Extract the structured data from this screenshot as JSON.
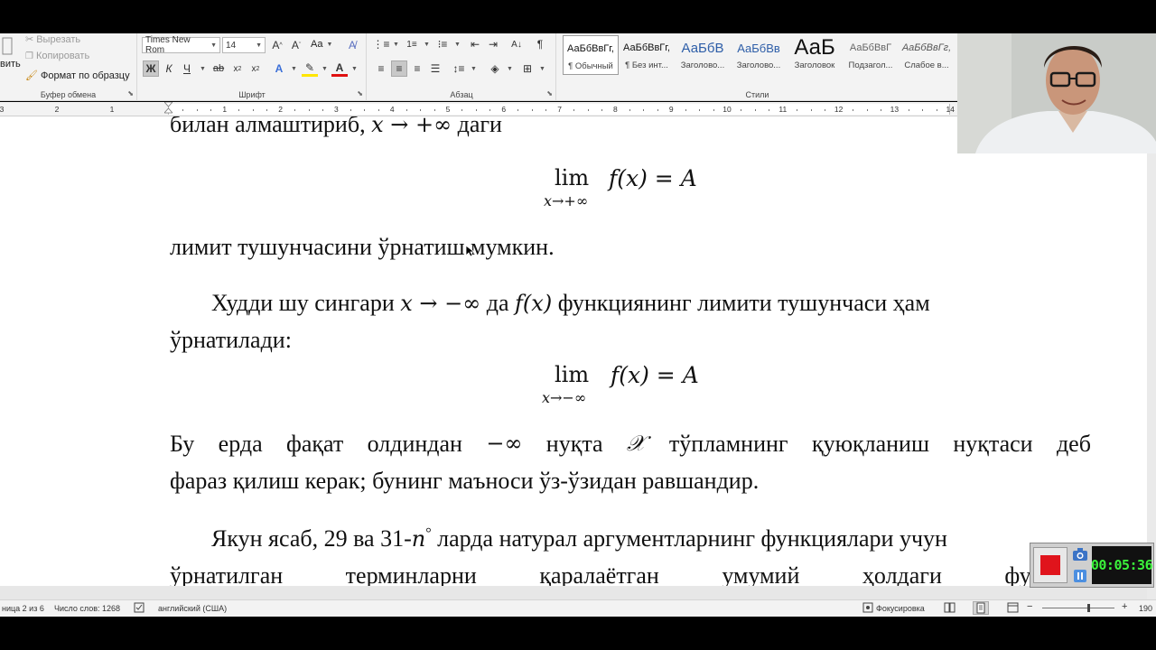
{
  "ribbon": {
    "clipboard": {
      "paste_partial": "вить",
      "cut": "Вырезать",
      "copy": "Копировать",
      "format_painter": "Формат по образцу",
      "group_label": "Буфер обмена"
    },
    "font": {
      "font_name": "Times New Rom",
      "font_size": "14",
      "change_case": "Aa",
      "bold": "Ж",
      "italic": "К",
      "underline": "Ч",
      "group_label": "Шрифт"
    },
    "paragraph": {
      "pilcrow": "¶",
      "group_label": "Абзац"
    },
    "styles": {
      "items": [
        {
          "sample": "АаБбВвГг,",
          "name": "¶ Обычный"
        },
        {
          "sample": "АаБбВвГг,",
          "name": "¶ Без инт..."
        },
        {
          "sample": "АаБбВ",
          "name": "Заголово..."
        },
        {
          "sample": "АаБбВв",
          "name": "Заголово..."
        },
        {
          "sample": "АаБ",
          "name": "Заголовок"
        },
        {
          "sample": "АаБбВвГ",
          "name": "Подзагол..."
        },
        {
          "sample": "АаБбВвГг,",
          "name": "Слабое в..."
        }
      ],
      "group_label": "Стили"
    }
  },
  "ruler": {
    "left_numbers": [
      "3",
      "2",
      "1"
    ],
    "numbers": [
      "1",
      "2",
      "3",
      "4",
      "5",
      "6",
      "7",
      "8",
      "9",
      "10",
      "11",
      "12",
      "13",
      "14"
    ]
  },
  "document": {
    "line1": "билан алмаштириб,",
    "line1_math": "x → +∞",
    "line1_end": "даги",
    "lim1": {
      "word": "lim",
      "sub": "x→+∞",
      "rhs": "f(x) = A"
    },
    "line2": "лимит тушунчасини ўрнатиш мумкин.",
    "para2": {
      "t1": "Худди шу сингари",
      "m1": "x → −∞",
      "t2": "да",
      "m2": "f(x)",
      "t3": "функциянинг лимити тушунчаси ҳам",
      "t4": "ўрнатилади:"
    },
    "lim2": {
      "word": "lim",
      "sub": "x→−∞",
      "rhs": "f(x) = A"
    },
    "para3": {
      "w": [
        "Бу",
        "ерда",
        "фақат",
        "олдиндан",
        "−∞",
        "нуқта",
        "𝒳",
        "тўпламнинг",
        "қуюқланиш",
        "нуқтаси",
        "деб"
      ],
      "line2": "фараз қилиш керак; бунинг маъноси ўз-ўзидан равшандир."
    },
    "para4": {
      "t1": "Якун ясаб, 29 ва 31-",
      "n": "n",
      "deg": "°",
      "t2": "ларда натурал аргументларнинг функциялари учун",
      "line2": [
        "ўрнатилган",
        "терминларни",
        "қаралаётган",
        "умумий",
        "ҳолдаги",
        "функция"
      ]
    }
  },
  "statusbar": {
    "page": "ница 2 из 6",
    "words": "Число слов: 1268",
    "language": "английский (США)",
    "focus": "Фокусировка",
    "zoom": "190"
  },
  "recorder": {
    "time": "00:05:36"
  }
}
